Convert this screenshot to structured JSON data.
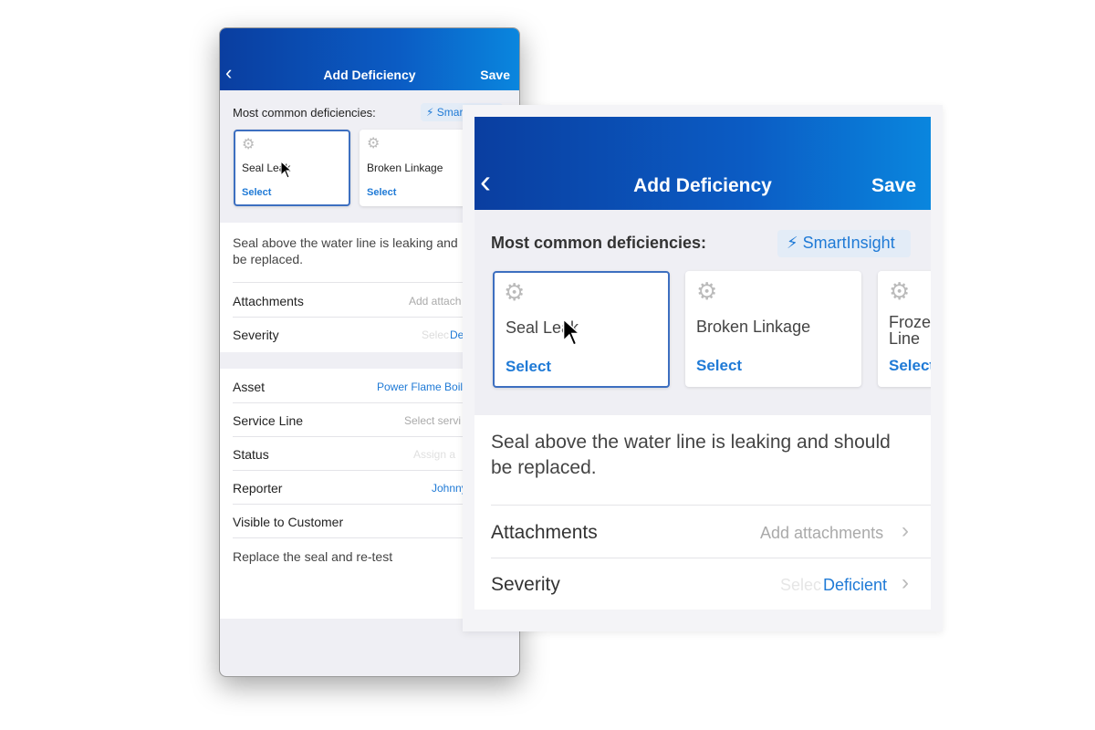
{
  "back_phone": {
    "header": {
      "back_icon": "chevron-left-icon",
      "title": "Add Deficiency",
      "save_label": "Save"
    },
    "common_label": "Most common deficiencies:",
    "smartinsight_label": "Smar",
    "cards": [
      {
        "name": "Seal Leak",
        "select": "Select",
        "selected": true
      },
      {
        "name": "Broken Linkage",
        "select": "Select"
      }
    ],
    "description": "Seal above the water line is leaking and",
    "description2": "be replaced.",
    "rows": [
      {
        "label": "Attachments",
        "value": "Add attach"
      },
      {
        "label": "Severity",
        "value_placeholder": "Selec",
        "value": "De"
      }
    ],
    "rows2": [
      {
        "label": "Asset",
        "value": "Power Flame Boil"
      },
      {
        "label": "Service Line",
        "value": "Select servi"
      },
      {
        "label": "Status",
        "value": "Assign a"
      },
      {
        "label": "Reporter",
        "value": "Johnny"
      },
      {
        "label": "Visible to Customer",
        "value": ""
      }
    ],
    "notes": "Replace the seal and re-test"
  },
  "zoom_panel": {
    "header": {
      "back_icon": "chevron-left-icon",
      "title": "Add Deficiency",
      "save_label": "Save"
    },
    "common_label": "Most common deficiencies:",
    "smartinsight_label": "SmartInsight",
    "smartinsight_icon": "lightning-bolt-icon",
    "cards": [
      {
        "name": "Seal Leak",
        "select": "Select",
        "selected": true
      },
      {
        "name": "Broken Linkage",
        "select": "Select"
      },
      {
        "name": "Froze",
        "name2": "Line",
        "select": "Select"
      }
    ],
    "description": "Seal above the water line is leaking and should",
    "description2": "be replaced.",
    "rows": [
      {
        "label": "Attachments",
        "value": "Add attachments"
      },
      {
        "label": "Severity",
        "value_placeholder": "Selec",
        "value": "Deficient"
      }
    ]
  },
  "colors": {
    "header_start": "#0a3ea0",
    "header_end": "#0a86de",
    "accent": "#1f7ad6"
  }
}
